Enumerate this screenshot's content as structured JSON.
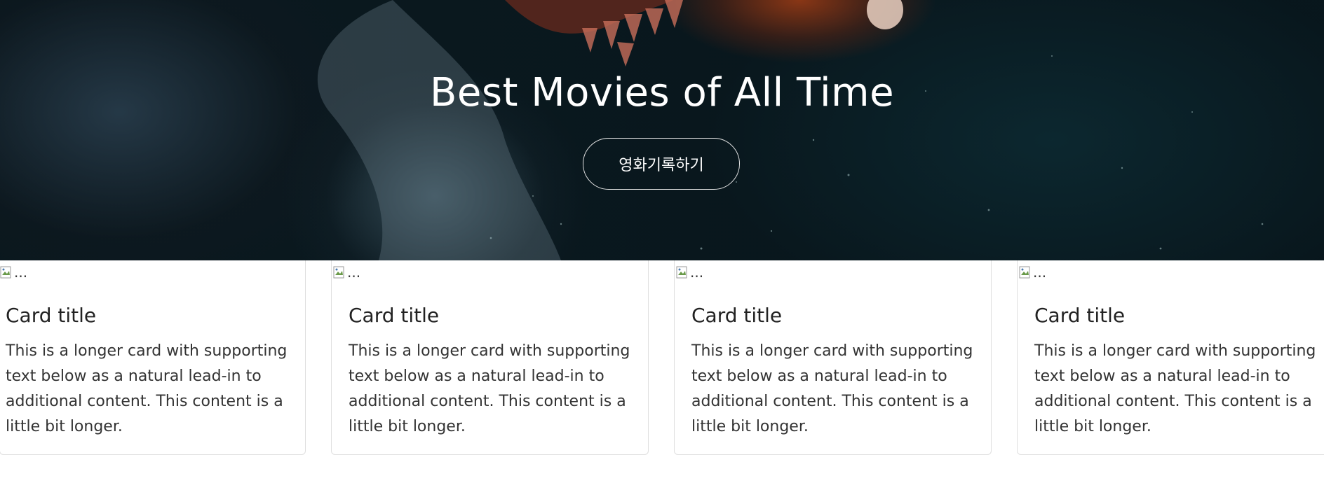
{
  "hero": {
    "title": "Best Movies of All Time",
    "button_label": "영화기록하기"
  },
  "cards": [
    {
      "image_alt": "...",
      "title": "Card title",
      "text": "This is a longer card with supporting text below as a natural lead-in to additional content. This content is a little bit longer."
    },
    {
      "image_alt": "...",
      "title": "Card title",
      "text": "This is a longer card with supporting text below as a natural lead-in to additional content. This content is a little bit longer."
    },
    {
      "image_alt": "...",
      "title": "Card title",
      "text": "This is a longer card with supporting text below as a natural lead-in to additional content. This content is a little bit longer."
    },
    {
      "image_alt": "...",
      "title": "Card title",
      "text": "This is a longer card with supporting text below as a natural lead-in to additional content. This content is a little bit longer."
    }
  ],
  "colors": {
    "hero_dark": "#0b1c22",
    "hero_accent": "#a03c14",
    "card_border": "#dfdfdf",
    "text_dark": "#222222"
  }
}
